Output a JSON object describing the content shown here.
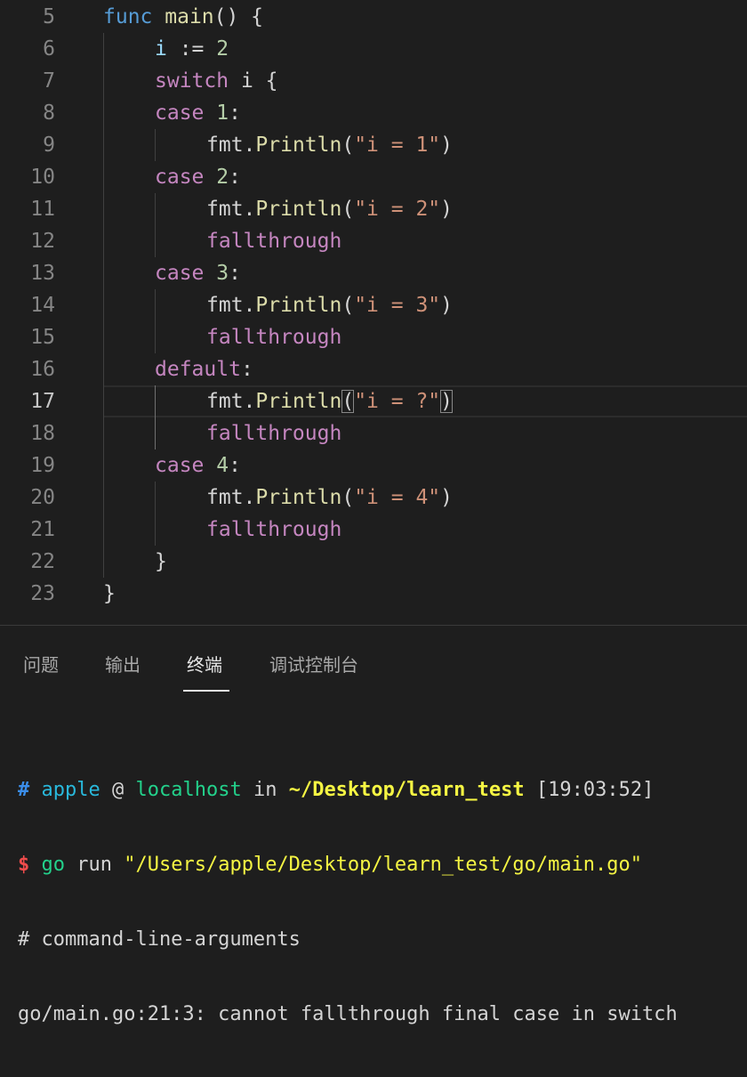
{
  "editor": {
    "current_line": 17,
    "lines": [
      {
        "number": "5",
        "indent": 0,
        "tokens": [
          {
            "t": "func",
            "c": "kw"
          },
          {
            "t": " ",
            "c": "plain"
          },
          {
            "t": "main",
            "c": "fn"
          },
          {
            "t": "() {",
            "c": "plain"
          }
        ]
      },
      {
        "number": "6",
        "indent": 1,
        "tokens": [
          {
            "t": "i",
            "c": "var"
          },
          {
            "t": " := ",
            "c": "op"
          },
          {
            "t": "2",
            "c": "num"
          }
        ]
      },
      {
        "number": "7",
        "indent": 1,
        "tokens": [
          {
            "t": "switch",
            "c": "ctrl"
          },
          {
            "t": " i {",
            "c": "plain"
          }
        ]
      },
      {
        "number": "8",
        "indent": 1,
        "tokens": [
          {
            "t": "case",
            "c": "ctrl"
          },
          {
            "t": " ",
            "c": "plain"
          },
          {
            "t": "1",
            "c": "num"
          },
          {
            "t": ":",
            "c": "plain"
          }
        ]
      },
      {
        "number": "9",
        "indent": 2,
        "tokens": [
          {
            "t": "fmt",
            "c": "plain"
          },
          {
            "t": ".",
            "c": "plain"
          },
          {
            "t": "Println",
            "c": "fn"
          },
          {
            "t": "(",
            "c": "plain"
          },
          {
            "t": "\"i = 1\"",
            "c": "str"
          },
          {
            "t": ")",
            "c": "plain"
          }
        ]
      },
      {
        "number": "10",
        "indent": 1,
        "tokens": [
          {
            "t": "case",
            "c": "ctrl"
          },
          {
            "t": " ",
            "c": "plain"
          },
          {
            "t": "2",
            "c": "num"
          },
          {
            "t": ":",
            "c": "plain"
          }
        ]
      },
      {
        "number": "11",
        "indent": 2,
        "tokens": [
          {
            "t": "fmt",
            "c": "plain"
          },
          {
            "t": ".",
            "c": "plain"
          },
          {
            "t": "Println",
            "c": "fn"
          },
          {
            "t": "(",
            "c": "plain"
          },
          {
            "t": "\"i = 2\"",
            "c": "str"
          },
          {
            "t": ")",
            "c": "plain"
          }
        ]
      },
      {
        "number": "12",
        "indent": 2,
        "tokens": [
          {
            "t": "fallthrough",
            "c": "ctrl"
          }
        ]
      },
      {
        "number": "13",
        "indent": 1,
        "tokens": [
          {
            "t": "case",
            "c": "ctrl"
          },
          {
            "t": " ",
            "c": "plain"
          },
          {
            "t": "3",
            "c": "num"
          },
          {
            "t": ":",
            "c": "plain"
          }
        ]
      },
      {
        "number": "14",
        "indent": 2,
        "tokens": [
          {
            "t": "fmt",
            "c": "plain"
          },
          {
            "t": ".",
            "c": "plain"
          },
          {
            "t": "Println",
            "c": "fn"
          },
          {
            "t": "(",
            "c": "plain"
          },
          {
            "t": "\"i = 3\"",
            "c": "str"
          },
          {
            "t": ")",
            "c": "plain"
          }
        ]
      },
      {
        "number": "15",
        "indent": 2,
        "tokens": [
          {
            "t": "fallthrough",
            "c": "ctrl"
          }
        ]
      },
      {
        "number": "16",
        "indent": 1,
        "tokens": [
          {
            "t": "default",
            "c": "ctrl"
          },
          {
            "t": ":",
            "c": "plain"
          }
        ]
      },
      {
        "number": "17",
        "indent": 2,
        "tokens": [
          {
            "t": "fmt",
            "c": "plain"
          },
          {
            "t": ".",
            "c": "plain"
          },
          {
            "t": "Println",
            "c": "fn"
          },
          {
            "t": "(",
            "c": "plain",
            "match": true
          },
          {
            "t": "\"i = ?\"",
            "c": "str"
          },
          {
            "t": ")",
            "c": "plain",
            "match": true
          }
        ]
      },
      {
        "number": "18",
        "indent": 2,
        "tokens": [
          {
            "t": "fallthrough",
            "c": "ctrl"
          }
        ]
      },
      {
        "number": "19",
        "indent": 1,
        "tokens": [
          {
            "t": "case",
            "c": "ctrl"
          },
          {
            "t": " ",
            "c": "plain"
          },
          {
            "t": "4",
            "c": "num"
          },
          {
            "t": ":",
            "c": "plain"
          }
        ]
      },
      {
        "number": "20",
        "indent": 2,
        "tokens": [
          {
            "t": "fmt",
            "c": "plain"
          },
          {
            "t": ".",
            "c": "plain"
          },
          {
            "t": "Println",
            "c": "fn"
          },
          {
            "t": "(",
            "c": "plain"
          },
          {
            "t": "\"i = 4\"",
            "c": "str"
          },
          {
            "t": ")",
            "c": "plain"
          }
        ]
      },
      {
        "number": "21",
        "indent": 2,
        "tokens": [
          {
            "t": "fallthrough",
            "c": "ctrl"
          }
        ]
      },
      {
        "number": "22",
        "indent": 1,
        "tokens": [
          {
            "t": "}",
            "c": "plain"
          }
        ]
      },
      {
        "number": "23",
        "indent": 0,
        "tokens": [
          {
            "t": "}",
            "c": "plain"
          }
        ]
      }
    ]
  },
  "panel": {
    "tabs": [
      {
        "label": "问题",
        "active": false
      },
      {
        "label": "输出",
        "active": false
      },
      {
        "label": "终端",
        "active": true
      },
      {
        "label": "调试控制台",
        "active": false
      }
    ]
  },
  "terminal": {
    "prompt": {
      "hash": "#",
      "user": "apple",
      "at": "@",
      "host": "localhost",
      "in": "in",
      "cwd": "~/Desktop/learn_test",
      "time": "[19:03:52]"
    },
    "command": {
      "dollar": "$",
      "cmd": "go",
      "arg": "run",
      "path": "\"/Users/apple/Desktop/learn_test/go/main.go\""
    },
    "output": [
      "# command-line-arguments",
      "go/main.go:21:3: cannot fallthrough final case in switch"
    ]
  },
  "colors": {
    "background": "#1e1e1e",
    "keyword": "#569cd6",
    "control": "#c586c0",
    "function": "#dcdcaa",
    "string": "#ce9178",
    "number": "#b5cea8",
    "variable": "#9cdcfe",
    "terminal_path": "#f5f543",
    "terminal_host": "#23d18b",
    "terminal_user": "#29b8db",
    "terminal_dollar": "#f14c4c"
  }
}
